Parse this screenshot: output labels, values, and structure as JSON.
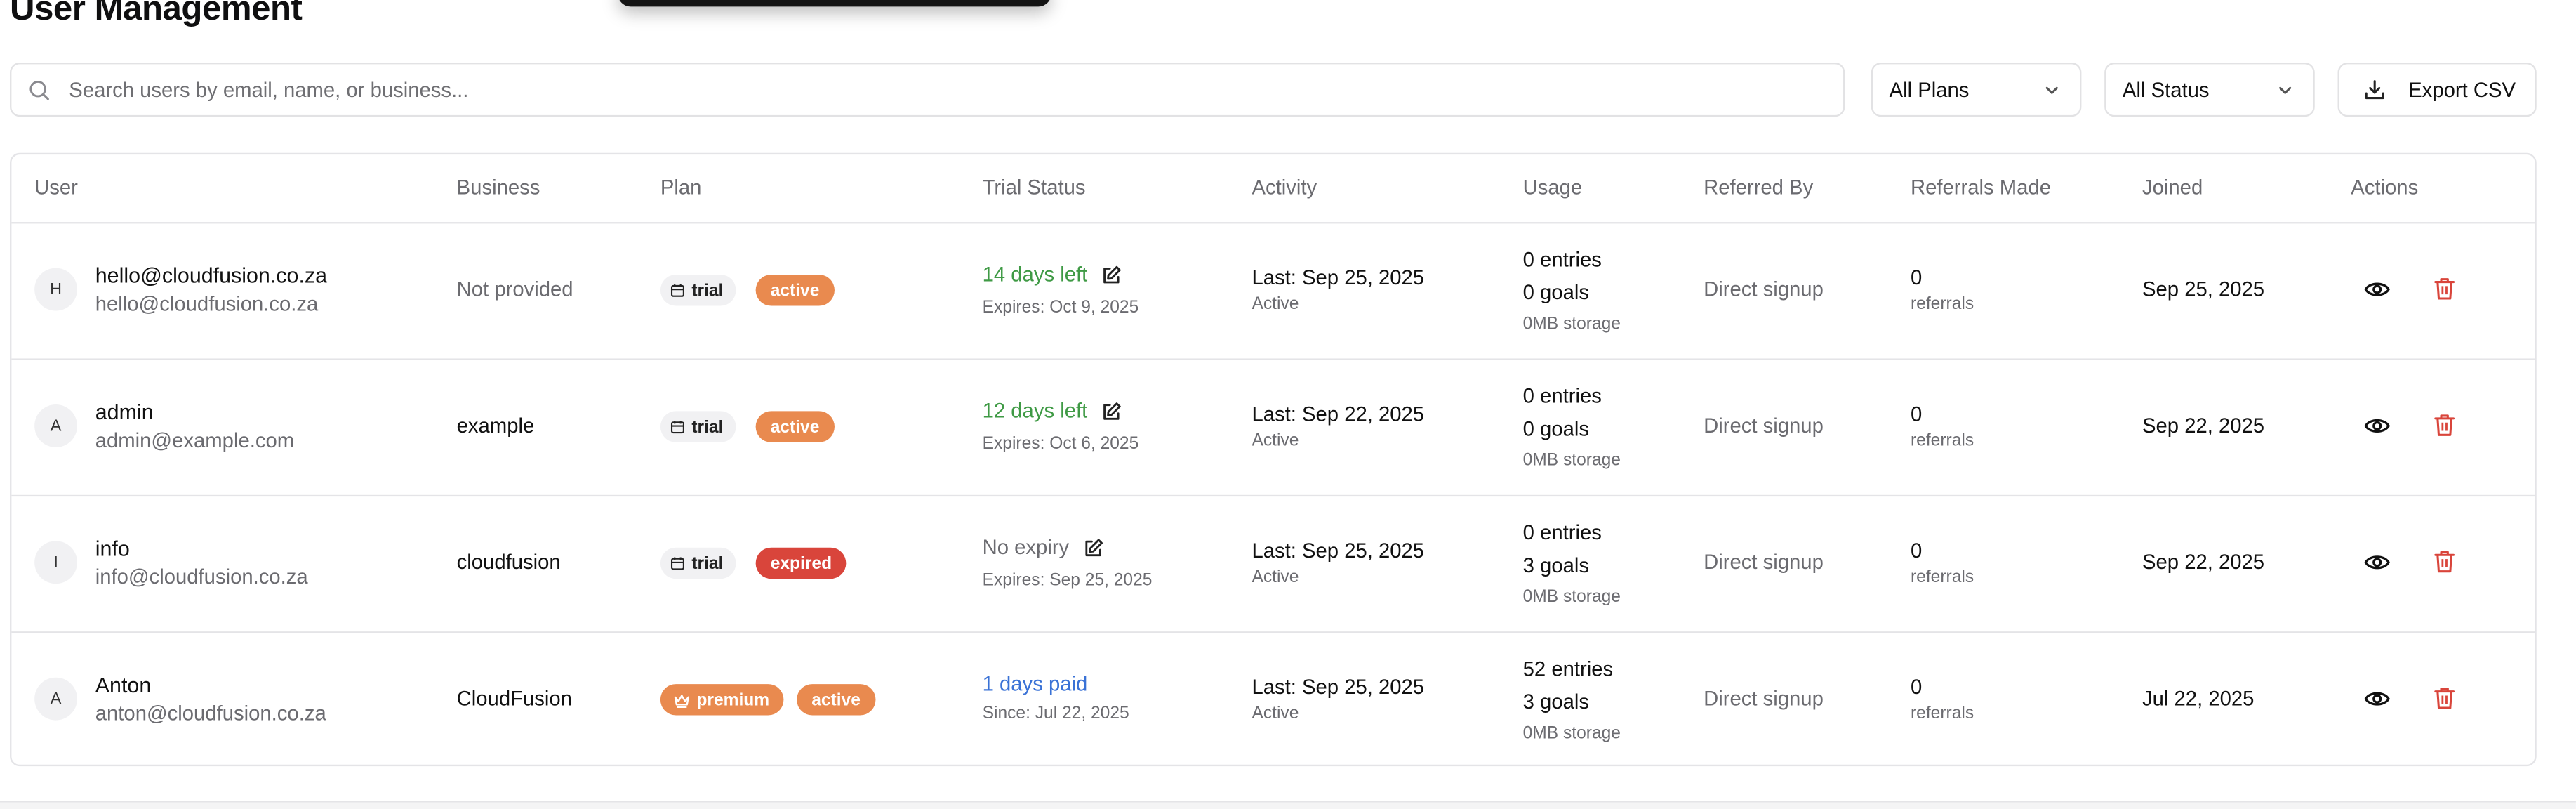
{
  "page": {
    "title": "User Management"
  },
  "toolbar": {
    "search_placeholder": "Search users by email, name, or business...",
    "plan_filter": "All Plans",
    "status_filter": "All Status",
    "export_label": "Export CSV"
  },
  "colors": {
    "green_text": "#3f9a45",
    "blue_text": "#3a72d6",
    "orange_badge": "#e98a4f",
    "red_badge": "#d9453b",
    "delete_icon": "#d9453b"
  },
  "table": {
    "headers": [
      "User",
      "Business",
      "Plan",
      "Trial Status",
      "Activity",
      "Usage",
      "Referred By",
      "Referrals Made",
      "Joined",
      "Actions"
    ],
    "rows": [
      {
        "initial": "H",
        "name": "hello@cloudfusion.co.za",
        "email": "hello@cloudfusion.co.za",
        "business": "Not provided",
        "plan": "trial",
        "status": "active",
        "trial_main": "14 days left",
        "trial_sub": "Expires: Oct 9, 2025",
        "activity": "Last: Sep 25, 2025",
        "activity_sub": "Active",
        "entries": "0 entries",
        "goals": "0 goals",
        "storage": "0MB storage",
        "referred_by": "Direct signup",
        "referrals": "0",
        "referrals_label": "referrals",
        "joined": "Sep 25, 2025"
      },
      {
        "initial": "A",
        "name": "admin",
        "email": "admin@example.com",
        "business": "example",
        "plan": "trial",
        "status": "active",
        "trial_main": "12 days left",
        "trial_sub": "Expires: Oct 6, 2025",
        "activity": "Last: Sep 22, 2025",
        "activity_sub": "Active",
        "entries": "0 entries",
        "goals": "0 goals",
        "storage": "0MB storage",
        "referred_by": "Direct signup",
        "referrals": "0",
        "referrals_label": "referrals",
        "joined": "Sep 22, 2025"
      },
      {
        "initial": "I",
        "name": "info",
        "email": "info@cloudfusion.co.za",
        "business": "cloudfusion",
        "plan": "trial",
        "status": "expired",
        "trial_main": "No expiry",
        "trial_sub": "Expires: Sep 25, 2025",
        "activity": "Last: Sep 25, 2025",
        "activity_sub": "Active",
        "entries": "0 entries",
        "goals": "3 goals",
        "storage": "0MB storage",
        "referred_by": "Direct signup",
        "referrals": "0",
        "referrals_label": "referrals",
        "joined": "Sep 22, 2025"
      },
      {
        "initial": "A",
        "name": "Anton",
        "email": "anton@cloudfusion.co.za",
        "business": "CloudFusion",
        "plan": "premium",
        "status": "active",
        "trial_main": "1 days paid",
        "trial_sub": "Since: Jul 22, 2025",
        "activity": "Last: Sep 25, 2025",
        "activity_sub": "Active",
        "entries": "52 entries",
        "goals": "3 goals",
        "storage": "0MB storage",
        "referred_by": "Direct signup",
        "referrals": "0",
        "referrals_label": "referrals",
        "joined": "Jul 22, 2025"
      }
    ]
  }
}
